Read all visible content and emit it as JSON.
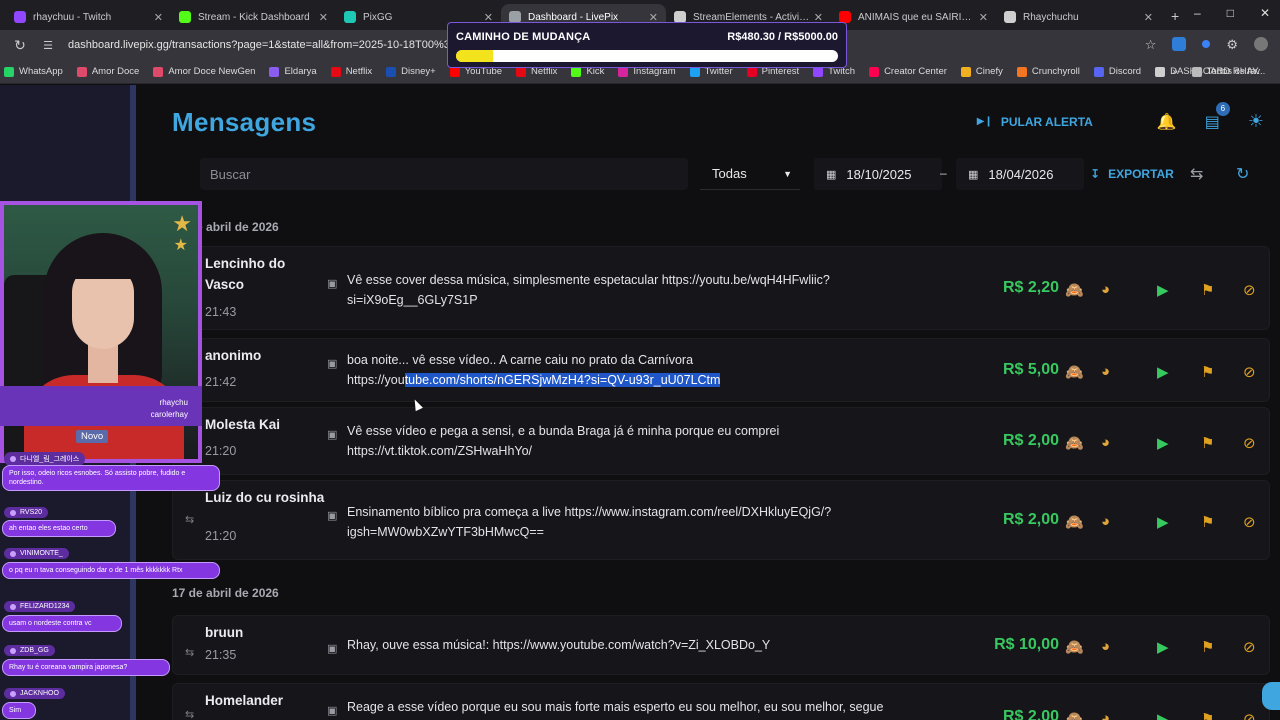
{
  "browser": {
    "tabs": [
      {
        "label": "rhaychuu - Twitch",
        "color": "#9146ff",
        "glyph": "t"
      },
      {
        "label": "Stream - Kick Dashboard",
        "color": "#53fc18",
        "glyph": "K"
      },
      {
        "label": "PixGG",
        "color": "#1ec8b5",
        "glyph": "<>"
      },
      {
        "label": "Dashboard - LivePix",
        "color": "#9aa0a6",
        "glyph": "o",
        "active": true
      },
      {
        "label": "StreamElements - Activity fee",
        "color": "#cfcfcf",
        "glyph": "S"
      },
      {
        "label": "ANIMAIS que eu SAIRIA NA P",
        "color": "#ff0000",
        "glyph": "▶"
      },
      {
        "label": "Rhaychuchu",
        "color": "#cfcfcf",
        "glyph": "o"
      }
    ],
    "url": "dashboard.livepix.gg/transactions?page=1&state=all&from=2025-10-18T00%3A00%3A",
    "bookmarks": [
      {
        "label": "WhatsApp",
        "color": "#25d366"
      },
      {
        "label": "Amor Doce",
        "color": "#e04a6a"
      },
      {
        "label": "Amor Doce NewGen",
        "color": "#e04a6a"
      },
      {
        "label": "Eldarya",
        "color": "#8a5cf0"
      },
      {
        "label": "Netflix",
        "color": "#e50914"
      },
      {
        "label": "Disney+",
        "color": "#1a4fb0"
      },
      {
        "label": "YouTube",
        "color": "#ff0000"
      },
      {
        "label": "Netflix",
        "color": "#e50914"
      },
      {
        "label": "Kick",
        "color": "#53fc18"
      },
      {
        "label": "Instagram",
        "color": "#d6249f"
      },
      {
        "label": "Twitter",
        "color": "#1da1f2"
      },
      {
        "label": "Pinterest",
        "color": "#e60023"
      },
      {
        "label": "Twitch",
        "color": "#9146ff"
      },
      {
        "label": "Creator Center",
        "color": "#ff0050"
      },
      {
        "label": "Cinefy",
        "color": "#f0b020"
      },
      {
        "label": "Crunchyroll",
        "color": "#f47521"
      },
      {
        "label": "Discord",
        "color": "#5865f2"
      },
      {
        "label": "DASHBOARD RHAY...",
        "color": "#cfcfcf"
      }
    ],
    "bookmarks_more": "»",
    "all_favorites": "Todos os fav"
  },
  "header": {
    "title": "Mensagens",
    "skip_alert": "PULAR ALERTA",
    "notif_badge": "6"
  },
  "filters": {
    "search_placeholder": "Buscar",
    "state": "Todas",
    "date_from": "18/10/2025",
    "date_to": "18/04/2026",
    "date_sep": "–",
    "export": "EXPORTAR"
  },
  "groups": [
    {
      "heading": "18 de abril de 2026"
    },
    {
      "heading": "17 de abril de 2026"
    }
  ],
  "rows": [
    {
      "name": "Lencinho do Vasco",
      "time": "21:43",
      "msg_a": "Vê esse cover dessa música, simplesmente espetacular https://youtu.be/wqH4HFwliic?si=iX9oEg__6GLy7S1P",
      "msg_sel": "",
      "msg_b": "",
      "amount": "R$ 2,20"
    },
    {
      "name": "anonimo",
      "time": "21:42",
      "msg_a": "boa noite... vê esse vídeo.. A carne caiu no prato da Carnívora https://you",
      "msg_sel": "tube.com/shorts/nGERSjwMzH4?si=QV-u93r_uU07LCtm",
      "msg_b": "",
      "amount": "R$ 5,00"
    },
    {
      "name": "Molesta Kai",
      "time": "21:20",
      "msg_a": "Vê esse vídeo e pega a sensi, e a bunda Braga já é minha porque eu comprei https://vt.tiktok.com/ZSHwaHhYo/",
      "msg_sel": "",
      "msg_b": "",
      "amount": "R$ 2,00"
    },
    {
      "name": "Luiz do cu rosinha",
      "time": "21:20",
      "msg_a": "Ensinamento bíblico pra começa a live https://www.instagram.com/reel/DXHkluyEQjG/?igsh=MW0wbXZwYTF3bHMwcQ==",
      "msg_sel": "",
      "msg_b": "",
      "amount": "R$ 2,00"
    },
    {
      "name": "bruun",
      "time": "21:35",
      "msg_a": "Rhay, ouve essa música!: https://www.youtube.com/watch?v=Zi_XLOBDo_Y",
      "msg_sel": "",
      "msg_b": "",
      "amount": "R$ 10,00"
    },
    {
      "name": "Homelander",
      "time": "",
      "msg_a": "Reage a esse vídeo porque eu sou mais forte mais esperto eu sou melhor, eu sou melhor, segue link",
      "msg_sel": "",
      "msg_b": "",
      "amount": "R$ 2,00"
    }
  ],
  "goal": {
    "title": "CAMINHO DE MUDANÇA",
    "value": "R$480.30 / R$5000.00",
    "progress": 0.096
  },
  "stream_overlay": {
    "social_1": "rhaychu",
    "social_2": "carolerhay",
    "new_label": "Novo",
    "chat": [
      {
        "user": "다니엘_림_그레이스",
        "text": "Por isso, odeio ricos esnobes. Só assisto pobre, fudido e nordestino."
      },
      {
        "user": "RVS20",
        "text": "ah entao eles estao certo"
      },
      {
        "user": "VINIMONTE_",
        "text": "o pq eu n tava conseguindo dar o de 1 mês kkkkkkk Rtx"
      },
      {
        "user": "FELIZARD1234",
        "text": "usam o nordeste contra vc"
      },
      {
        "user": "ZDB_GG",
        "text": "Rhay tu é coreana vampira japonesa?"
      },
      {
        "user": "JACKNHOO",
        "text": "Sim"
      }
    ]
  }
}
